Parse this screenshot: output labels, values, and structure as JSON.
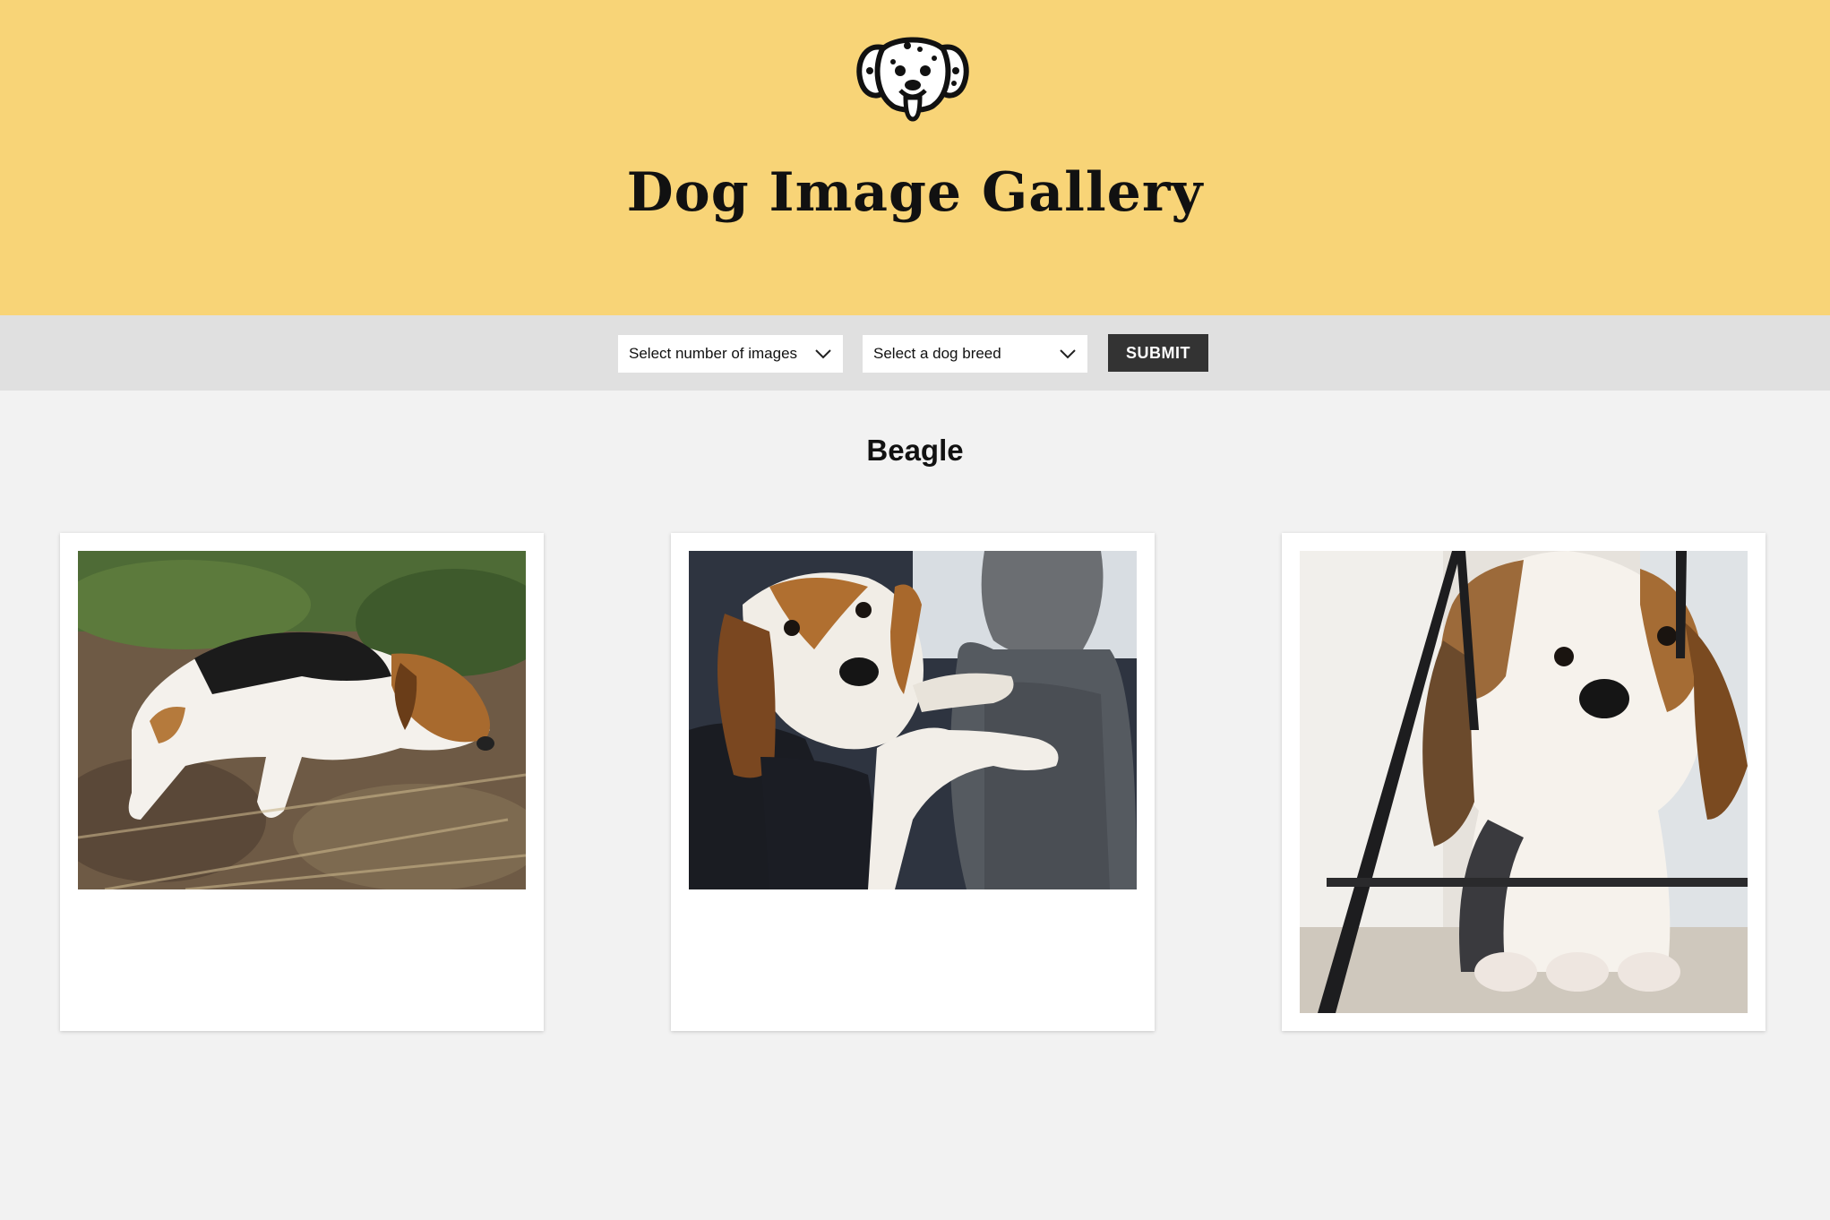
{
  "header": {
    "title": "Dog Image Gallery",
    "logo_icon": "dalmatian-head-icon",
    "background": "#f8d477"
  },
  "toolbar": {
    "count_select": {
      "placeholder": "Select number of images"
    },
    "breed_select": {
      "placeholder": "Select a dog breed"
    },
    "submit_label": "SUBMIT"
  },
  "gallery": {
    "breed_heading": "Beagle",
    "images": [
      {
        "alt": "Beagle lying on dirt and grass"
      },
      {
        "alt": "Beagle sitting in a car seat"
      },
      {
        "alt": "Beagle puppy sitting under a chair"
      }
    ]
  }
}
